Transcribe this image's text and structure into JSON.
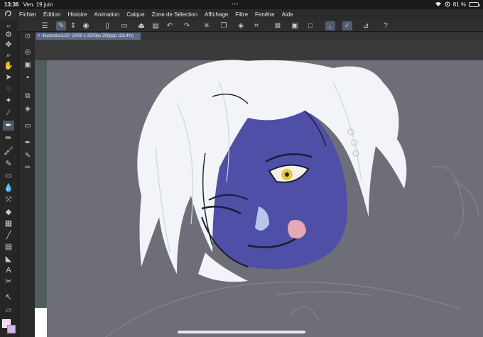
{
  "status": {
    "time": "13:36",
    "date": "Ven. 19 juin",
    "dots": "•••",
    "battery": "81 %"
  },
  "menu": {
    "items": [
      "Fichier",
      "Édition",
      "Histoire",
      "Animation",
      "Calque",
      "Zone de Sélection",
      "Affichage",
      "Filtre",
      "Fenêtre",
      "Aide"
    ]
  },
  "tab": {
    "close": "×",
    "title": "Illustration125* (3000 x 3500px 300ppp 128.4%)"
  },
  "canvas": {
    "bg": "#6e6e78",
    "skin": "#4f4fa8",
    "hair": "#f2f4f7"
  }
}
